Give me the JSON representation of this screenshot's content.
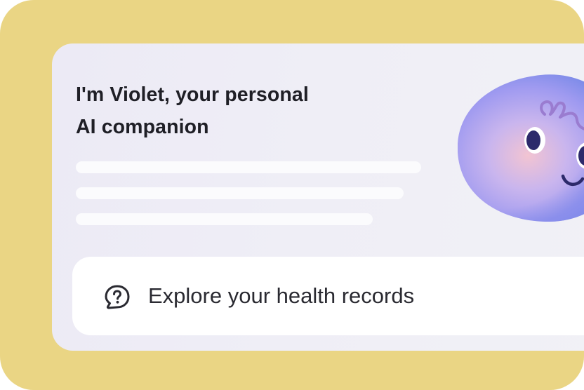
{
  "intro": {
    "title_line1": "I'm Violet, your personal",
    "title_line2": "AI companion"
  },
  "avatar": {
    "name": "violet-avatar",
    "colors": {
      "blob_light": "#c5b4f3",
      "blob_dark": "#6f7fe6",
      "blush": "#f2c4d2",
      "eye": "#2c2a6b",
      "hair_stroke": "#9a7cd0"
    }
  },
  "action": {
    "label": "Explore your health records",
    "icon": "question-chat-icon"
  },
  "colors": {
    "background": "#ead584",
    "card": "#eeedf5",
    "skeleton": "#fbfbfd",
    "text": "#1f1f26"
  }
}
